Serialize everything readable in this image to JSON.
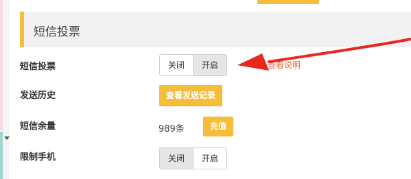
{
  "section": {
    "title": "短信投票"
  },
  "rows": {
    "vote": {
      "label": "短信投票",
      "toggle": {
        "off_label": "关闭",
        "on_label": "开启",
        "selected": "开启"
      },
      "help_label": "查看说明"
    },
    "history": {
      "label": "发送历史",
      "button_label": "查看发送记录"
    },
    "balance": {
      "label": "短信余量",
      "value": "989条",
      "recharge_label": "充值"
    },
    "limit_phone": {
      "label": "限制手机",
      "toggle": {
        "off_label": "关闭",
        "on_label": "开启",
        "selected": "关闭"
      }
    }
  },
  "colors": {
    "accent": "#f5bd3a",
    "annotation_arrow": "#e8281f",
    "help_text": "#e06a3d"
  }
}
